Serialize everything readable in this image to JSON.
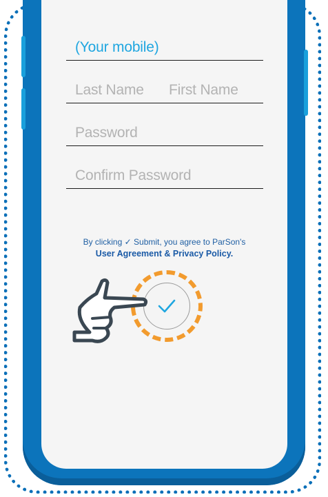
{
  "form": {
    "mobile_placeholder": "(Your mobile)",
    "last_name_placeholder": "Last Name",
    "first_name_placeholder": "First Name",
    "password_placeholder": "Password",
    "confirm_password_placeholder": "Confirm Password"
  },
  "agreement": {
    "prefix": "By clicking",
    "check_glyph": "✓",
    "suffix": "Submit, you agree to ParSon's",
    "link": "User Agreement & Privacy Policy."
  },
  "icons": {
    "submit": "check-icon",
    "pointer": "pointing-hand-icon"
  },
  "colors": {
    "phone_blue": "#0c74bb",
    "accent_cyan": "#1fa6e0",
    "highlight_orange": "#f29b2e",
    "screen_bg": "#f5f5f5"
  }
}
